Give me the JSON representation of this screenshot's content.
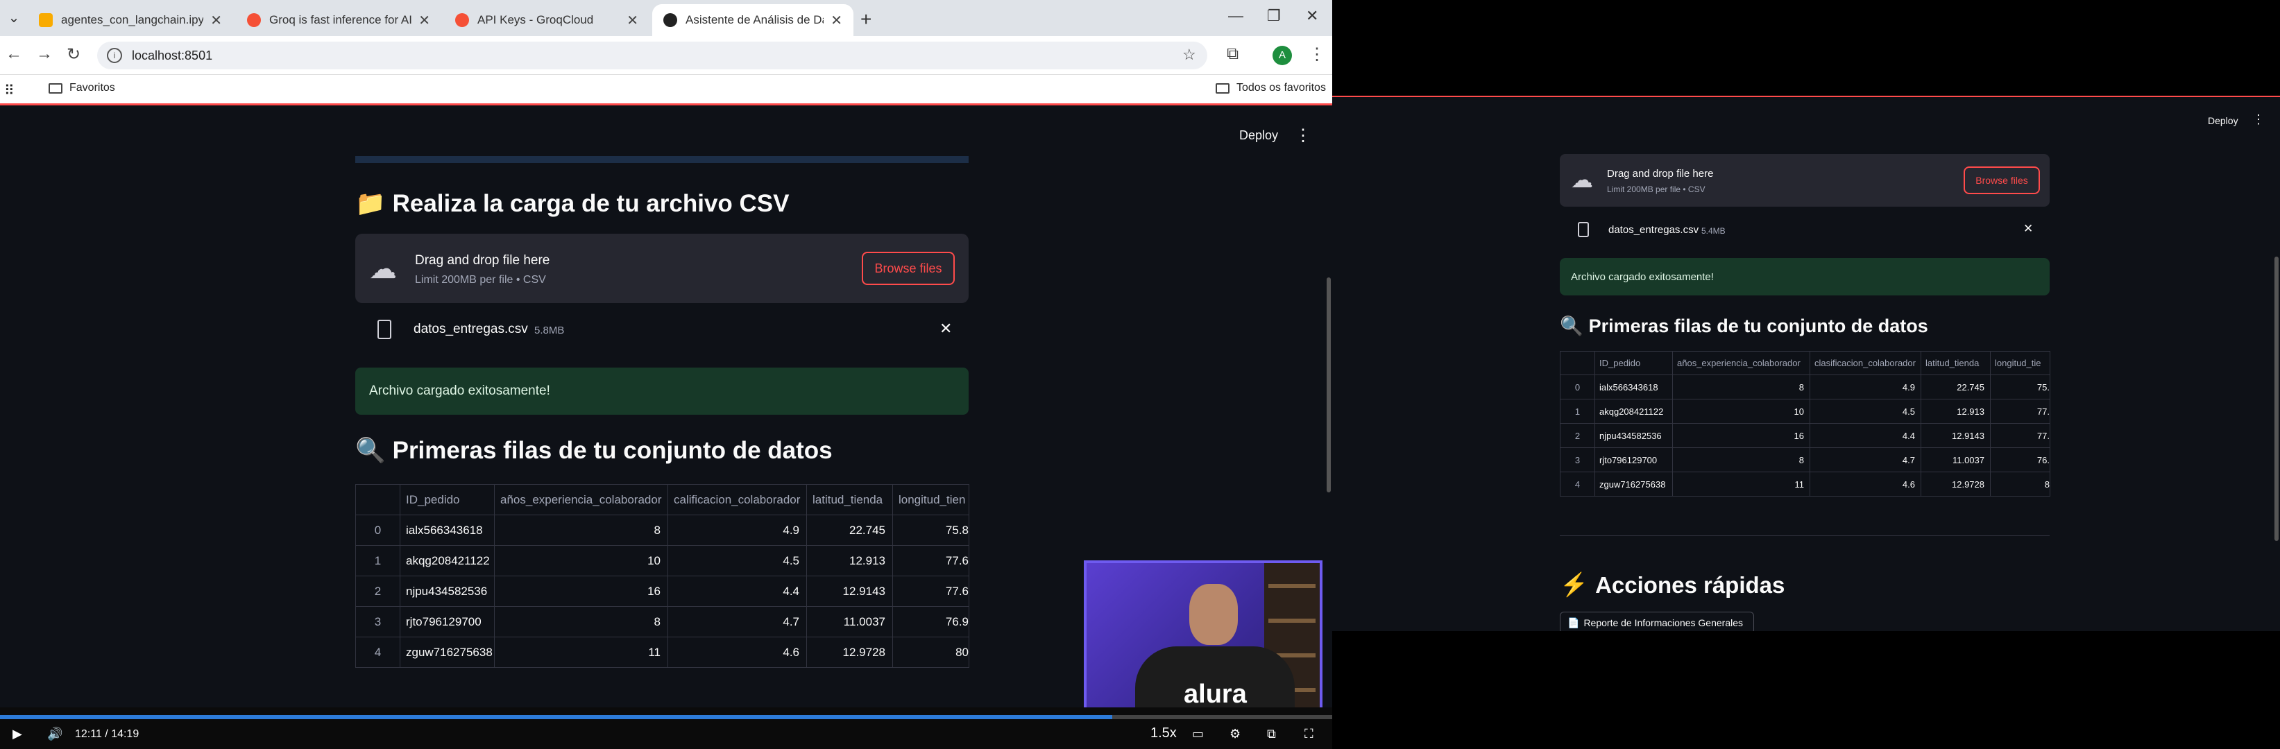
{
  "browser": {
    "tabs": [
      {
        "label": "agentes_con_langchain.ipynb",
        "color": "#f9ab00"
      },
      {
        "label": "Groq is fast inference for AI bui",
        "color": "#f55036"
      },
      {
        "label": "API Keys - GroqCloud",
        "color": "#f55036"
      },
      {
        "label": "Asistente de Análisis de Datos",
        "color": "#222222"
      }
    ],
    "url": "localhost:8501",
    "bookmarks": {
      "favorites": "Favoritos",
      "all": "Todos os favoritos"
    },
    "profile_initial": "A"
  },
  "app": {
    "deploy": "Deploy",
    "upload_header": {
      "emoji": "📁",
      "text": "Realiza la carga de tu archivo CSV"
    },
    "uploader": {
      "drag": "Drag and drop file here",
      "limit": "Limit 200MB per file • CSV",
      "browse": "Browse files"
    },
    "file": {
      "name": "datos_entregas.csv",
      "size": "5.8MB"
    },
    "success": "Archivo cargado exitosamente!",
    "preview_header": {
      "emoji": "🔍",
      "text": "Primeras filas de tu conjunto de datos"
    },
    "table": {
      "columns": [
        "ID_pedido",
        "años_experiencia_colaborador",
        "calificacion_colaborador",
        "latitud_tienda",
        "longitud_tien"
      ],
      "rows": [
        {
          "idx": "0",
          "id": "ialx566343618",
          "exp": "8",
          "cal": "4.9",
          "lat": "22.745",
          "lon": "75.8"
        },
        {
          "idx": "1",
          "id": "akqg208421122",
          "exp": "10",
          "cal": "4.5",
          "lat": "12.913",
          "lon": "77.6"
        },
        {
          "idx": "2",
          "id": "njpu434582536",
          "exp": "16",
          "cal": "4.4",
          "lat": "12.9143",
          "lon": "77.6"
        },
        {
          "idx": "3",
          "id": "rjto796129700",
          "exp": "8",
          "cal": "4.7",
          "lat": "11.0037",
          "lon": "76.9"
        },
        {
          "idx": "4",
          "id": "zguw716275638",
          "exp": "11",
          "cal": "4.6",
          "lat": "12.9728",
          "lon": "80"
        }
      ]
    }
  },
  "video": {
    "time": "12:11 / 14:19",
    "speed": "1.5x",
    "progress": 0.835,
    "cam_logo": "alura"
  },
  "right_app": {
    "deploy": "Deploy",
    "uploader": {
      "drag": "Drag and drop file here",
      "limit": "Limit 200MB per file • CSV",
      "browse": "Browse files"
    },
    "file": {
      "name": "datos_entregas.csv",
      "size": "5.4MB"
    },
    "success": "Archivo cargado exitosamente!",
    "preview_header": {
      "emoji": "🔍",
      "text": "Primeras filas de tu conjunto de datos"
    },
    "table": {
      "columns": [
        "ID_pedido",
        "años_experiencia_colaborador",
        "clasificacion_colaborador",
        "latitud_tienda",
        "longitud_tie"
      ],
      "rows": [
        {
          "idx": "0",
          "id": "ialx566343618",
          "exp": "8",
          "cal": "4.9",
          "lat": "22.745",
          "lon": "75."
        },
        {
          "idx": "1",
          "id": "akqg208421122",
          "exp": "10",
          "cal": "4.5",
          "lat": "12.913",
          "lon": "77."
        },
        {
          "idx": "2",
          "id": "njpu434582536",
          "exp": "16",
          "cal": "4.4",
          "lat": "12.9143",
          "lon": "77."
        },
        {
          "idx": "3",
          "id": "rjto796129700",
          "exp": "8",
          "cal": "4.7",
          "lat": "11.0037",
          "lon": "76."
        },
        {
          "idx": "4",
          "id": "zguw716275638",
          "exp": "11",
          "cal": "4.6",
          "lat": "12.9728",
          "lon": "8"
        }
      ]
    },
    "quick_header": {
      "emoji": "⚡",
      "text": "Acciones rápidas"
    },
    "quick_button": "Reporte de Informaciones Generales"
  }
}
